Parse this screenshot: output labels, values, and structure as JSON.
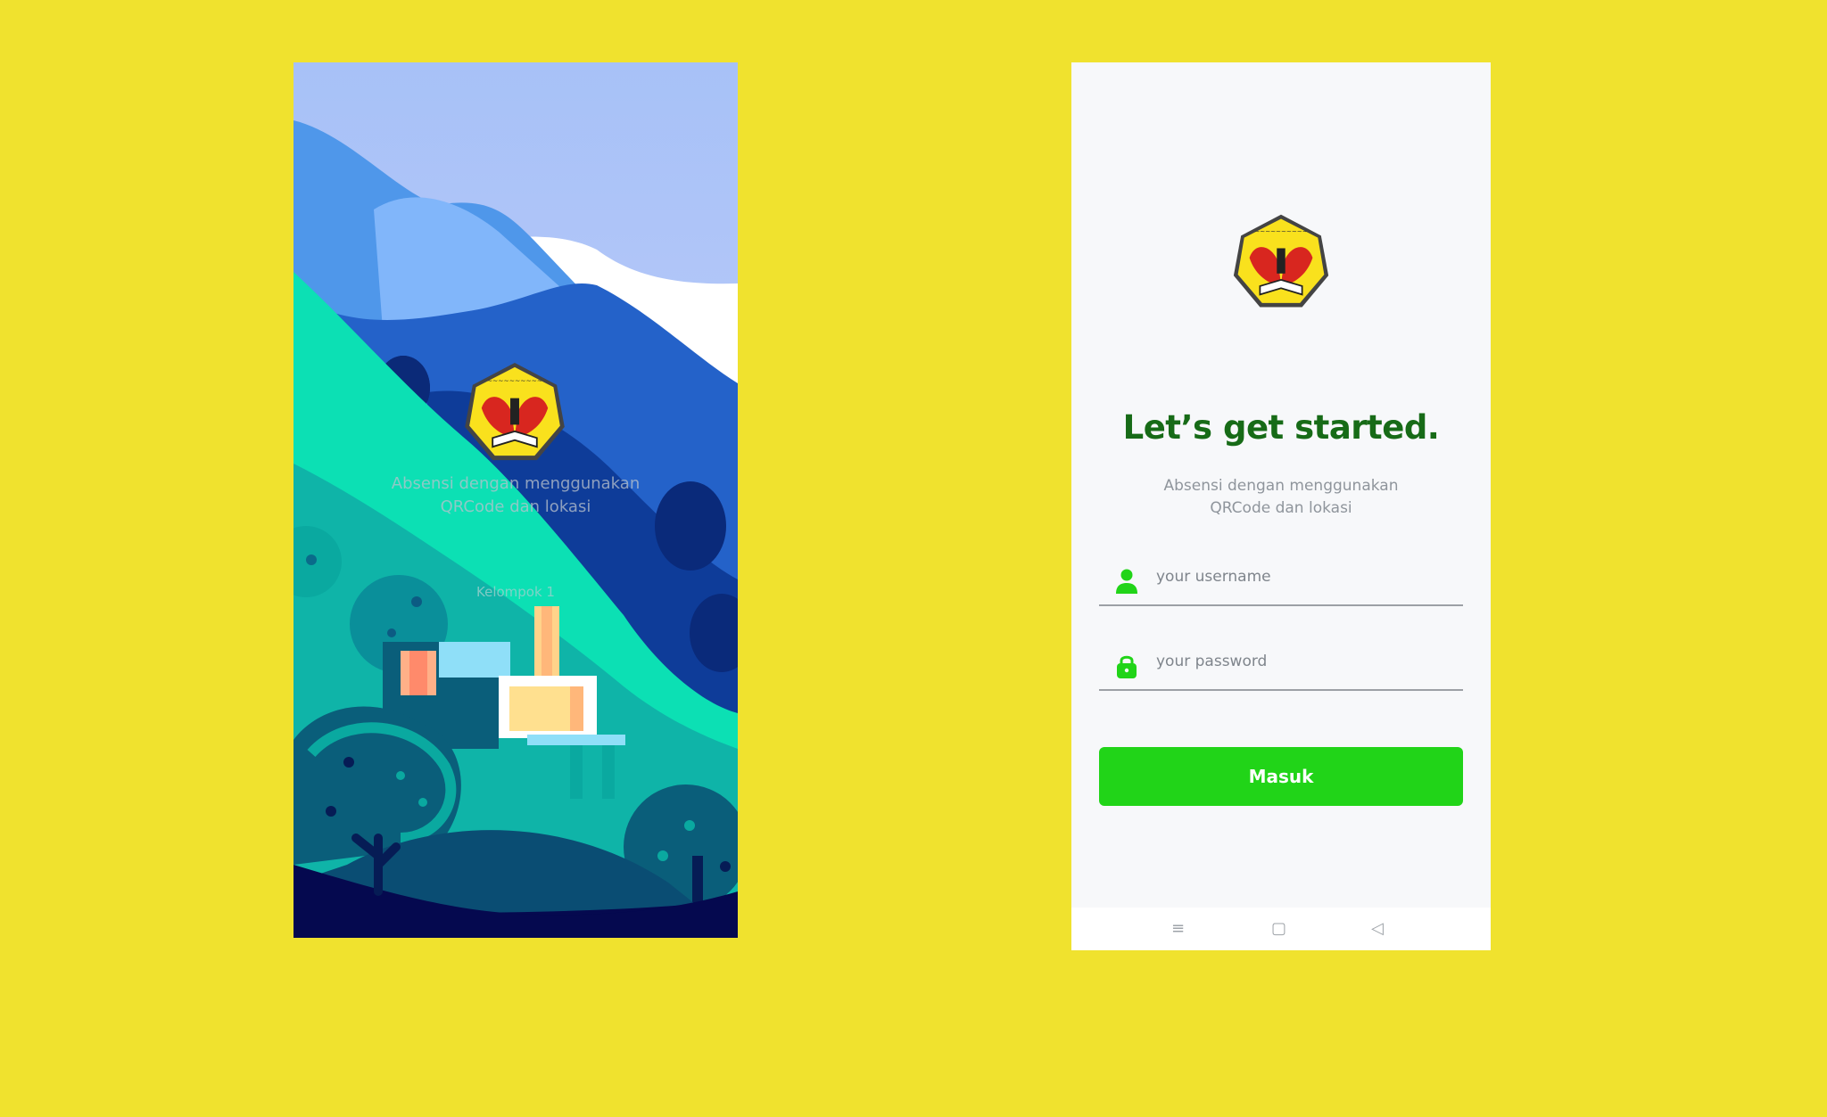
{
  "splash": {
    "tagline_line1": "Absensi dengan menggunakan",
    "tagline_line2": "QRCode dan lokasi",
    "group_label": "Kelompok 1"
  },
  "login": {
    "title": "Let’s get started.",
    "subtitle_line1": "Absensi dengan menggunakan",
    "subtitle_line2": "QRCode dan lokasi",
    "username_placeholder": "your username",
    "password_placeholder": "your password",
    "submit_label": "Masuk",
    "icons": [
      "user-icon",
      "lock-icon"
    ]
  },
  "navbar": {
    "menu_icon": "≡",
    "home_icon": "▢",
    "back_icon": "◁"
  },
  "colors": {
    "background": "#f0e22e",
    "accent": "#21d418",
    "title": "#176b17"
  }
}
